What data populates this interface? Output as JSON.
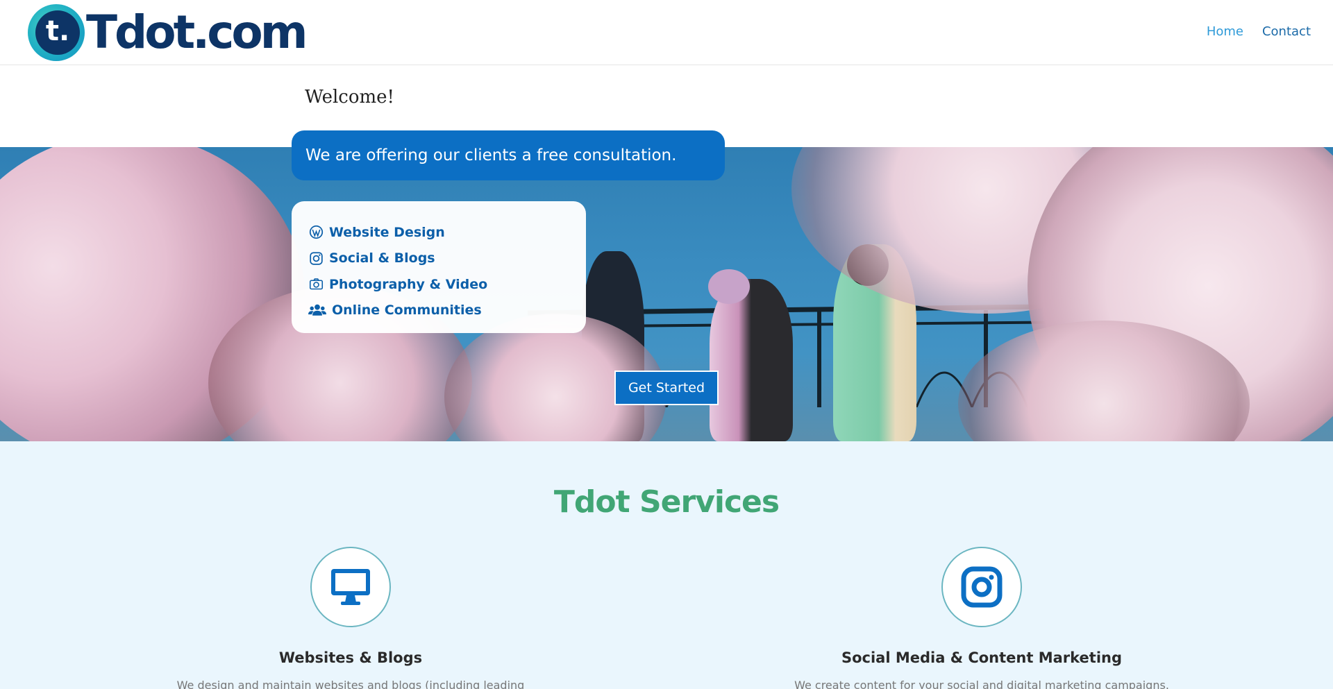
{
  "header": {
    "logo_mark": "t.",
    "logo_text": "Tdot.com",
    "nav": [
      {
        "label": "Home",
        "active": true
      },
      {
        "label": "Contact",
        "active": false
      }
    ]
  },
  "welcome": "Welcome!",
  "hero": {
    "offer_text": "We are offering our clients a free consultation.",
    "services": [
      {
        "icon": "wordpress-icon",
        "label": "Website Design"
      },
      {
        "icon": "instagram-icon",
        "label": "Social & Blogs"
      },
      {
        "icon": "camera-icon",
        "label": "Photography & Video"
      },
      {
        "icon": "users-icon",
        "label": "Online Communities"
      }
    ],
    "cta_label": "Get Started"
  },
  "services_section": {
    "title": "Tdot Services",
    "columns": [
      {
        "icon": "desktop-icon",
        "title": "Websites & Blogs",
        "description": "We design and maintain websites and blogs (including leading"
      },
      {
        "icon": "instagram-icon",
        "title": "Social Media & Content Marketing",
        "description": "We create content for your social and digital marketing campaigns."
      }
    ]
  },
  "colors": {
    "brand_navy": "#0d3466",
    "brand_blue": "#0c6fc4",
    "accent_green": "#41a675",
    "section_bg": "#eaf6fd"
  }
}
